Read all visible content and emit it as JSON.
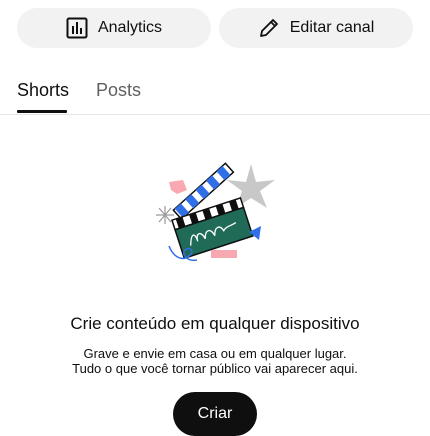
{
  "top_actions": {
    "analytics_label": "Analytics",
    "analytics_icon": "bar-chart-icon",
    "edit_label": "Editar canal",
    "edit_icon": "pencil-icon"
  },
  "tabs": [
    {
      "label": "Shorts",
      "selected": true
    },
    {
      "label": "Posts",
      "selected": false
    }
  ],
  "empty_state": {
    "illustration": "clapperboard-illustration",
    "title": "Crie conteúdo em qualquer dispositivo",
    "line1": "Grave e envie em casa ou em qualquer lugar.",
    "line2": "Tudo o que você tornar público vai aparecer aqui.",
    "button_label": "Criar"
  },
  "colors": {
    "pill_bg": "#f2f2f2",
    "text": "#0f0f0f",
    "muted": "#606060",
    "button_bg": "#0f0f0f",
    "clapper_green": "#1f6b57",
    "stripe_blue": "#2f6fe8",
    "pink": "#f7a8b0"
  }
}
